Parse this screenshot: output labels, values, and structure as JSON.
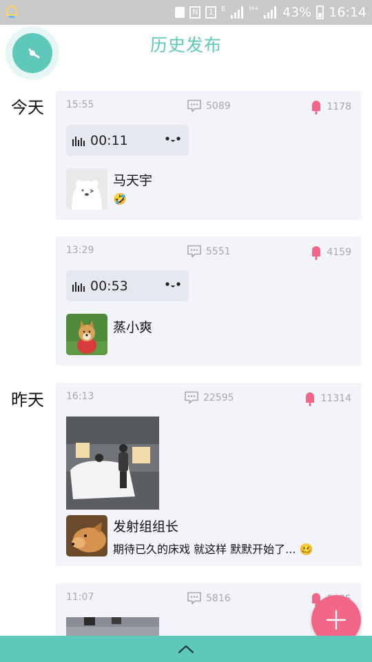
{
  "status_bar": {
    "battery": "43%",
    "time": "16:14",
    "network_label": "H+",
    "network_small": "E"
  },
  "header": {
    "title": "历史发布"
  },
  "sections": {
    "today": "今天",
    "yesterday": "昨天"
  },
  "posts": [
    {
      "time": "15:55",
      "comments": "5089",
      "likes": "1178",
      "voice_duration": "00:11",
      "author": "马天宇",
      "message_emoji": "🤣"
    },
    {
      "time": "13:29",
      "comments": "5551",
      "likes": "4159",
      "voice_duration": "00:53",
      "author": "蒸小爽"
    },
    {
      "time": "16:13",
      "comments": "22595",
      "likes": "11314",
      "author": "发射组组长",
      "message": "期待已久的床戏 就这样 默默开始了... 🥴"
    },
    {
      "time": "11:07",
      "comments": "5816",
      "likes": "5435"
    }
  ],
  "icons": {
    "clock": "clock-icon",
    "comment": "comment-bubble-icon",
    "like": "popsicle-icon",
    "voice": "voice-wave-icon",
    "add": "plus-icon",
    "collapse": "chevron-up-icon"
  },
  "colors": {
    "accent": "#5ec8bb",
    "fab": "#f26687",
    "like": "#f26687",
    "card_bg": "#f2f4f9",
    "status_bar": "#c9c9c9"
  }
}
